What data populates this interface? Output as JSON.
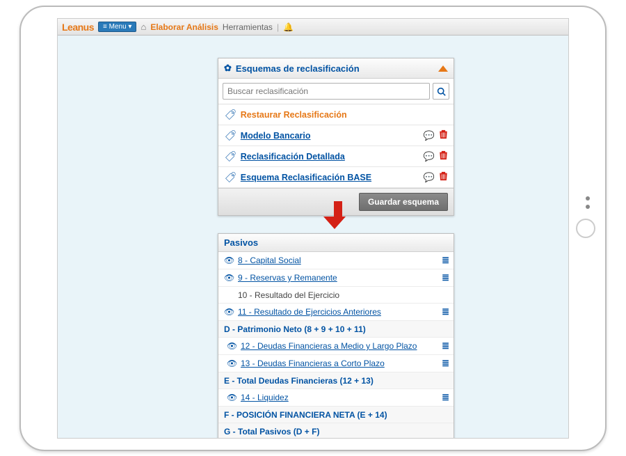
{
  "app": {
    "logo": "Leanus",
    "menu_btn": "≡ Menu ▾"
  },
  "nav": {
    "elaborar": "Elaborar Análisis",
    "herramientas": "Herramientas"
  },
  "schemes_panel": {
    "title": "Esquemas de reclasificación",
    "search_placeholder": "Buscar reclasificación",
    "restore": "Restaurar Reclasificación",
    "items": [
      {
        "label": "Modelo Bancario"
      },
      {
        "label": "Reclasificación Detallada"
      },
      {
        "label": "Esquema Reclasificación BASE"
      }
    ],
    "save_btn": "Guardar esquema"
  },
  "pasivos_panel": {
    "title": "Pasivos",
    "rows": [
      {
        "type": "item",
        "label": "8 - Capital Social",
        "eye": true,
        "list": true
      },
      {
        "type": "item",
        "label": "9 - Reservas y Remanente",
        "eye": true,
        "list": true
      },
      {
        "type": "plain",
        "label": "10 - Resultado del Ejercicio"
      },
      {
        "type": "item",
        "label": "11 - Resultado de Ejercicios Anteriores",
        "eye": true,
        "list": true
      },
      {
        "type": "subtotal",
        "label": "D - Patrimonio Neto (8 + 9 + 10 + 11)"
      },
      {
        "type": "item",
        "label": "12 - Deudas Financieras a Medio y Largo Plazo",
        "eye": true,
        "list": true,
        "indent": true
      },
      {
        "type": "item",
        "label": "13 - Deudas Financieras a Corto Plazo",
        "eye": true,
        "list": true,
        "indent": true
      },
      {
        "type": "subtotal",
        "label": "E - Total Deudas Financieras (12 + 13)"
      },
      {
        "type": "item",
        "label": "14 - Liquidez",
        "eye": true,
        "list": true,
        "indent": true
      },
      {
        "type": "subtotal",
        "label": "F - POSICIÓN FINANCIERA NETA (E + 14)"
      },
      {
        "type": "subtotal",
        "label": "G - Total Pasivos (D + F)"
      }
    ]
  }
}
